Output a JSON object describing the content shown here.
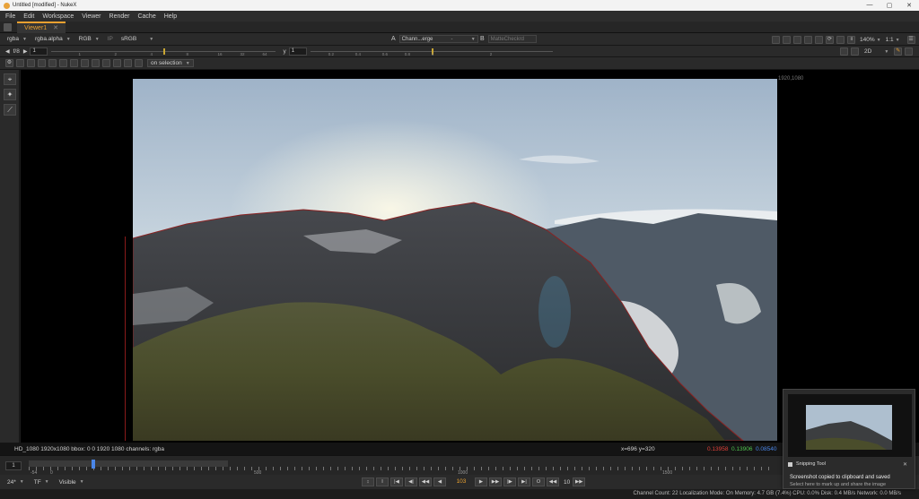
{
  "window": {
    "title": "Untitled [modified] - NukeX",
    "controls": [
      "—",
      "▢",
      "✕"
    ]
  },
  "menu": [
    "File",
    "Edit",
    "Workspace",
    "Viewer",
    "Render",
    "Cache",
    "Help"
  ],
  "tab": {
    "label": "Viewer1",
    "close": "✕"
  },
  "toolbar1": {
    "channels": "rgba",
    "alpha": "rgba.alpha",
    "display": "RGB",
    "ip": "IP",
    "colorspace": "sRGB",
    "input_a_label": "A",
    "input_a": "Chann...erge",
    "input_a_sep": "-",
    "input_b_label": "B",
    "input_b": "MatteCheckrd",
    "zoom": "140%",
    "ratio": "1:1"
  },
  "toolbar2": {
    "fstop": "f/8",
    "frame": "1",
    "y_label": "y",
    "y_value": "1",
    "gain_ticks": [
      "1",
      "2",
      "4",
      "8",
      "16",
      "32",
      "64"
    ],
    "gamma_ticks": [
      "0.2",
      "0.4",
      "0.6",
      "0.8",
      "1",
      "2"
    ],
    "view_mode": "2D"
  },
  "toolbar3": {
    "roi_mode": "on selection"
  },
  "left_tools": [
    "⌖",
    "✦",
    "⟋"
  ],
  "viewer": {
    "format_label": "1920,1080"
  },
  "info_bar": {
    "format": "HD_1080 1920x1080  bbox: 0 0 1920 1080 channels: rgba",
    "coords": "x=696 y=320",
    "r": "0.13958",
    "g": "0.13906",
    "b": "0.08540"
  },
  "timeline": {
    "current": "1",
    "range_start": "-54",
    "start": "0",
    "labels": [
      "500",
      "1000",
      "1500"
    ],
    "playhead_frame": 103
  },
  "bottom": {
    "fps": "24*",
    "tf": "TF",
    "visible": "Visible",
    "current_frame": "103",
    "increment": "10",
    "buttons": [
      "I",
      "|◀",
      "◀|",
      "◀◀",
      "◀",
      "▶",
      "▶▶",
      "|▶",
      "▶|",
      "O",
      "◀◀",
      "▶▶"
    ]
  },
  "status": "Channel Count: 22  Localization Mode: On  Memory: 4.7 GB (7.4%)  CPU: 0.0%  Disk: 0.4 MB/s  Network: 0.0 MB/s",
  "toast": {
    "app": "Snipping Tool",
    "message": "Screenshot copied to clipboard and saved",
    "sub": "Select here to mark up and share the image",
    "close": "✕"
  }
}
